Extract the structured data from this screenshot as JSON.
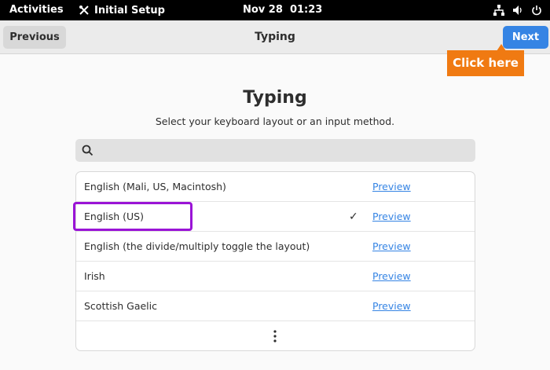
{
  "topbar": {
    "activities": "Activities",
    "app_name": "Initial Setup",
    "clock": "Nov 28  01:23",
    "tray_icons": [
      "network-icon",
      "volume-icon",
      "power-icon"
    ]
  },
  "header": {
    "previous_label": "Previous",
    "title": "Typing",
    "next_label": "Next"
  },
  "callout": {
    "text": "Click here"
  },
  "main": {
    "title": "Typing",
    "subtitle": "Select your keyboard layout or an input method.",
    "search": {
      "value": "",
      "placeholder": ""
    },
    "layouts": [
      {
        "label": "English (Mali, US, Macintosh)",
        "selected": false,
        "preview": "Preview"
      },
      {
        "label": "English (US)",
        "selected": true,
        "check": "✓",
        "preview": "Preview"
      },
      {
        "label": "English (the divide/multiply toggle the layout)",
        "selected": false,
        "preview": "Preview"
      },
      {
        "label": "Irish",
        "selected": false,
        "preview": "Preview"
      },
      {
        "label": "Scottish Gaelic",
        "selected": false,
        "preview": "Preview"
      }
    ]
  },
  "colors": {
    "accent": "#3584e4",
    "callout": "#f07a12",
    "highlight": "#9a14d6"
  }
}
